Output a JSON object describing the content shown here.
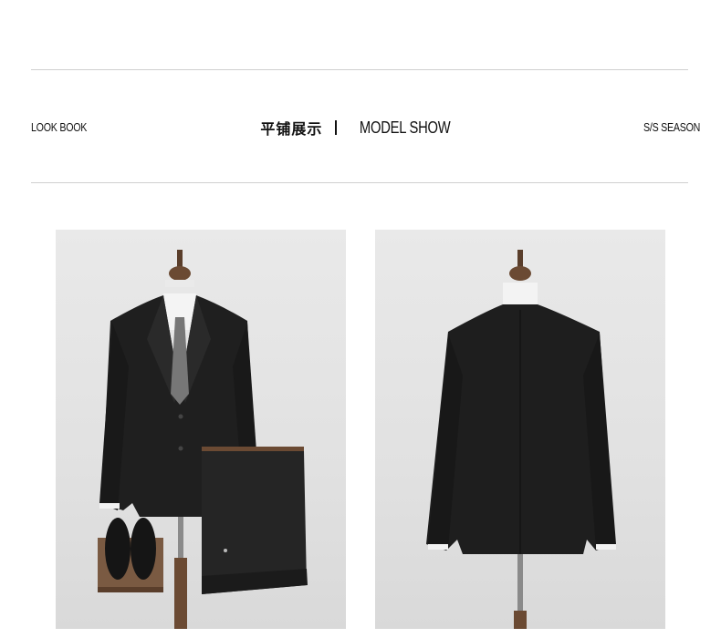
{
  "header": {
    "left_label": "LOOK BOOK",
    "center_cn": "平铺展示",
    "center_en": "MODEL SHOW",
    "right_label": "S/S SEASON"
  },
  "photos": [
    {
      "view": "front",
      "subject": "suit-front-with-trousers-and-shoes"
    },
    {
      "view": "back",
      "subject": "suit-back"
    }
  ],
  "colors": {
    "suit": "#1e1e1e",
    "background": "#e3e3e3",
    "divider": "#cfcfcf"
  }
}
